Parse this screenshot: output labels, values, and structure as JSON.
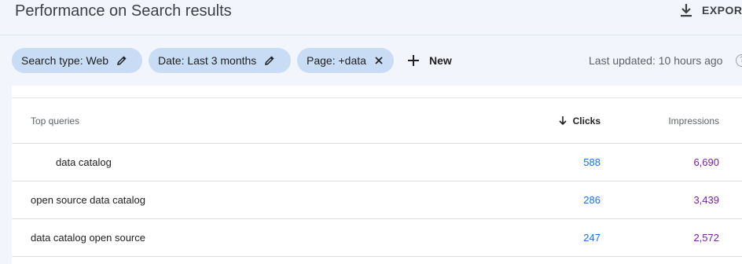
{
  "header": {
    "title": "Performance on Search results",
    "export_label": "EXPORT",
    "export_icon": "download-icon"
  },
  "filters": {
    "chips": [
      {
        "label": "Search type: Web",
        "icon": "pencil-icon"
      },
      {
        "label": "Date: Last 3 months",
        "icon": "pencil-icon"
      },
      {
        "label": "Page: +data",
        "icon": "close-icon"
      }
    ],
    "new_label": "New",
    "last_updated": "Last updated: 10 hours ago"
  },
  "table": {
    "columns": {
      "query": "Top queries",
      "clicks": "Clicks",
      "impressions": "Impressions"
    },
    "sort_icon": "arrow-down-icon",
    "rows": [
      {
        "query": "data catalog",
        "clicks": "588",
        "impressions": "6,690"
      },
      {
        "query": "open source data catalog",
        "clicks": "286",
        "impressions": "3,439"
      },
      {
        "query": "data catalog open source",
        "clicks": "247",
        "impressions": "2,572"
      }
    ]
  },
  "colors": {
    "chip_bg": "#c9dcf5",
    "clicks": "#1a73e8",
    "impressions": "#7b1fa2",
    "page_bg": "#f2f5fb"
  }
}
